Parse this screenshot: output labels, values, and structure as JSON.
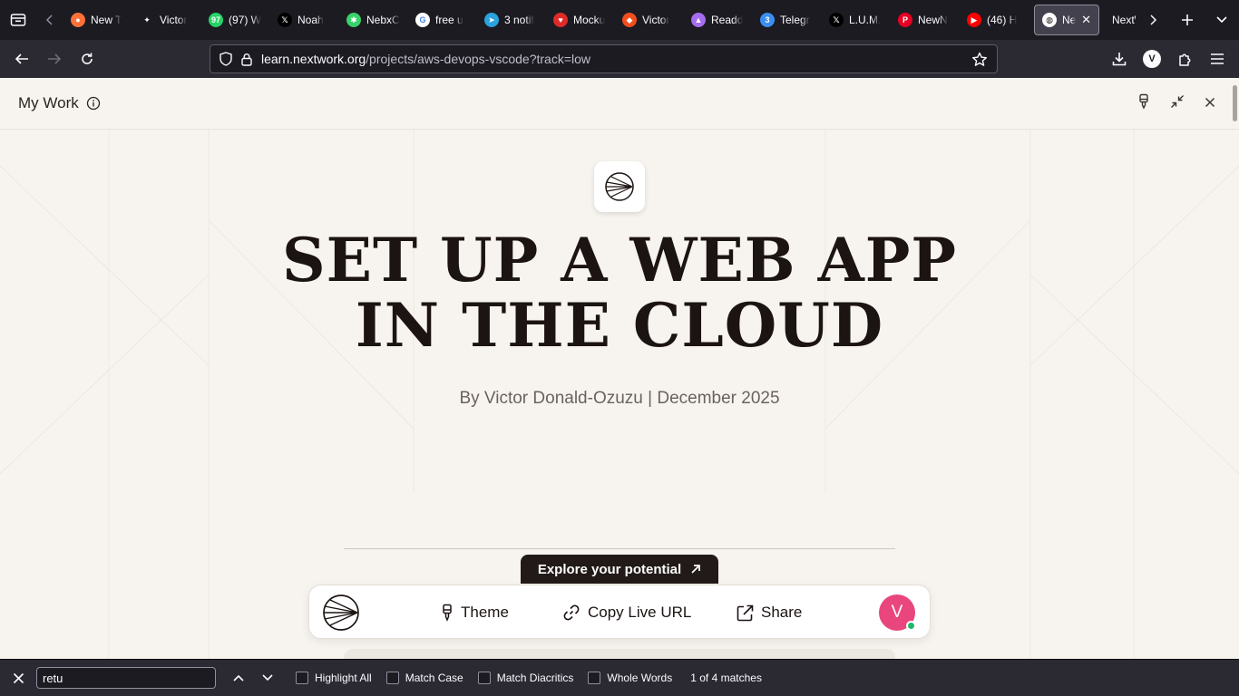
{
  "tabstrip": {
    "tabs": [
      {
        "label": "New T",
        "icon": "firefox-icon",
        "color": "#ff7139"
      },
      {
        "label": "Victor",
        "icon": "sparkle-icon",
        "color": "#1c1b22"
      },
      {
        "label": "(97) W",
        "icon": "whatsapp-icon",
        "color": "#25d366",
        "badge": "97"
      },
      {
        "label": "Noah",
        "icon": "x-icon",
        "color": "#000000"
      },
      {
        "label": "NebxC",
        "icon": "green-app-icon",
        "color": "#38d26b"
      },
      {
        "label": "free u",
        "icon": "google-icon",
        "color": "#ffffff"
      },
      {
        "label": "3 notif",
        "icon": "telegram-icon",
        "color": "#2aa3df"
      },
      {
        "label": "Mocku",
        "icon": "mockup-icon",
        "color": "#e02a2a"
      },
      {
        "label": "Victor",
        "icon": "figma-icon",
        "color": "#f24e1e"
      },
      {
        "label": "Readd",
        "icon": "readdy-icon",
        "color": "#a66cf0"
      },
      {
        "label": "Telegr",
        "icon": "telegram-badge-icon",
        "color": "#3a8ef0",
        "badge": "3"
      },
      {
        "label": "L.U.M.",
        "icon": "x-icon",
        "color": "#000000"
      },
      {
        "label": "NewN",
        "icon": "pinterest-icon",
        "color": "#e60023"
      },
      {
        "label": "(46) H",
        "icon": "youtube-icon",
        "color": "#ff0000"
      }
    ],
    "active_tab": {
      "label": "Nex",
      "icon": "nextwork-icon"
    },
    "after_tab": {
      "label": "NextW"
    }
  },
  "navbar": {
    "url_host": "learn.nextwork.org",
    "url_path": "/projects/aws-devops-vscode?track=low",
    "account_initial": "V"
  },
  "page": {
    "header_title": "My Work",
    "hero_line1": "SET UP A WEB APP",
    "hero_line2": "IN THE CLOUD",
    "byline": "By Victor Donald-Ozuzu | December 2025",
    "explore_label": "Explore your potential",
    "toolbar": {
      "theme_label": "Theme",
      "copy_label": "Copy Live URL",
      "share_label": "Share",
      "avatar_initial": "V",
      "avatar_color": "#e8467c"
    }
  },
  "findbar": {
    "query": "retu",
    "highlight_all": "Highlight All",
    "match_case": "Match Case",
    "match_diacritics": "Match Diacritics",
    "whole_words": "Whole Words",
    "status": "1 of 4 matches"
  }
}
